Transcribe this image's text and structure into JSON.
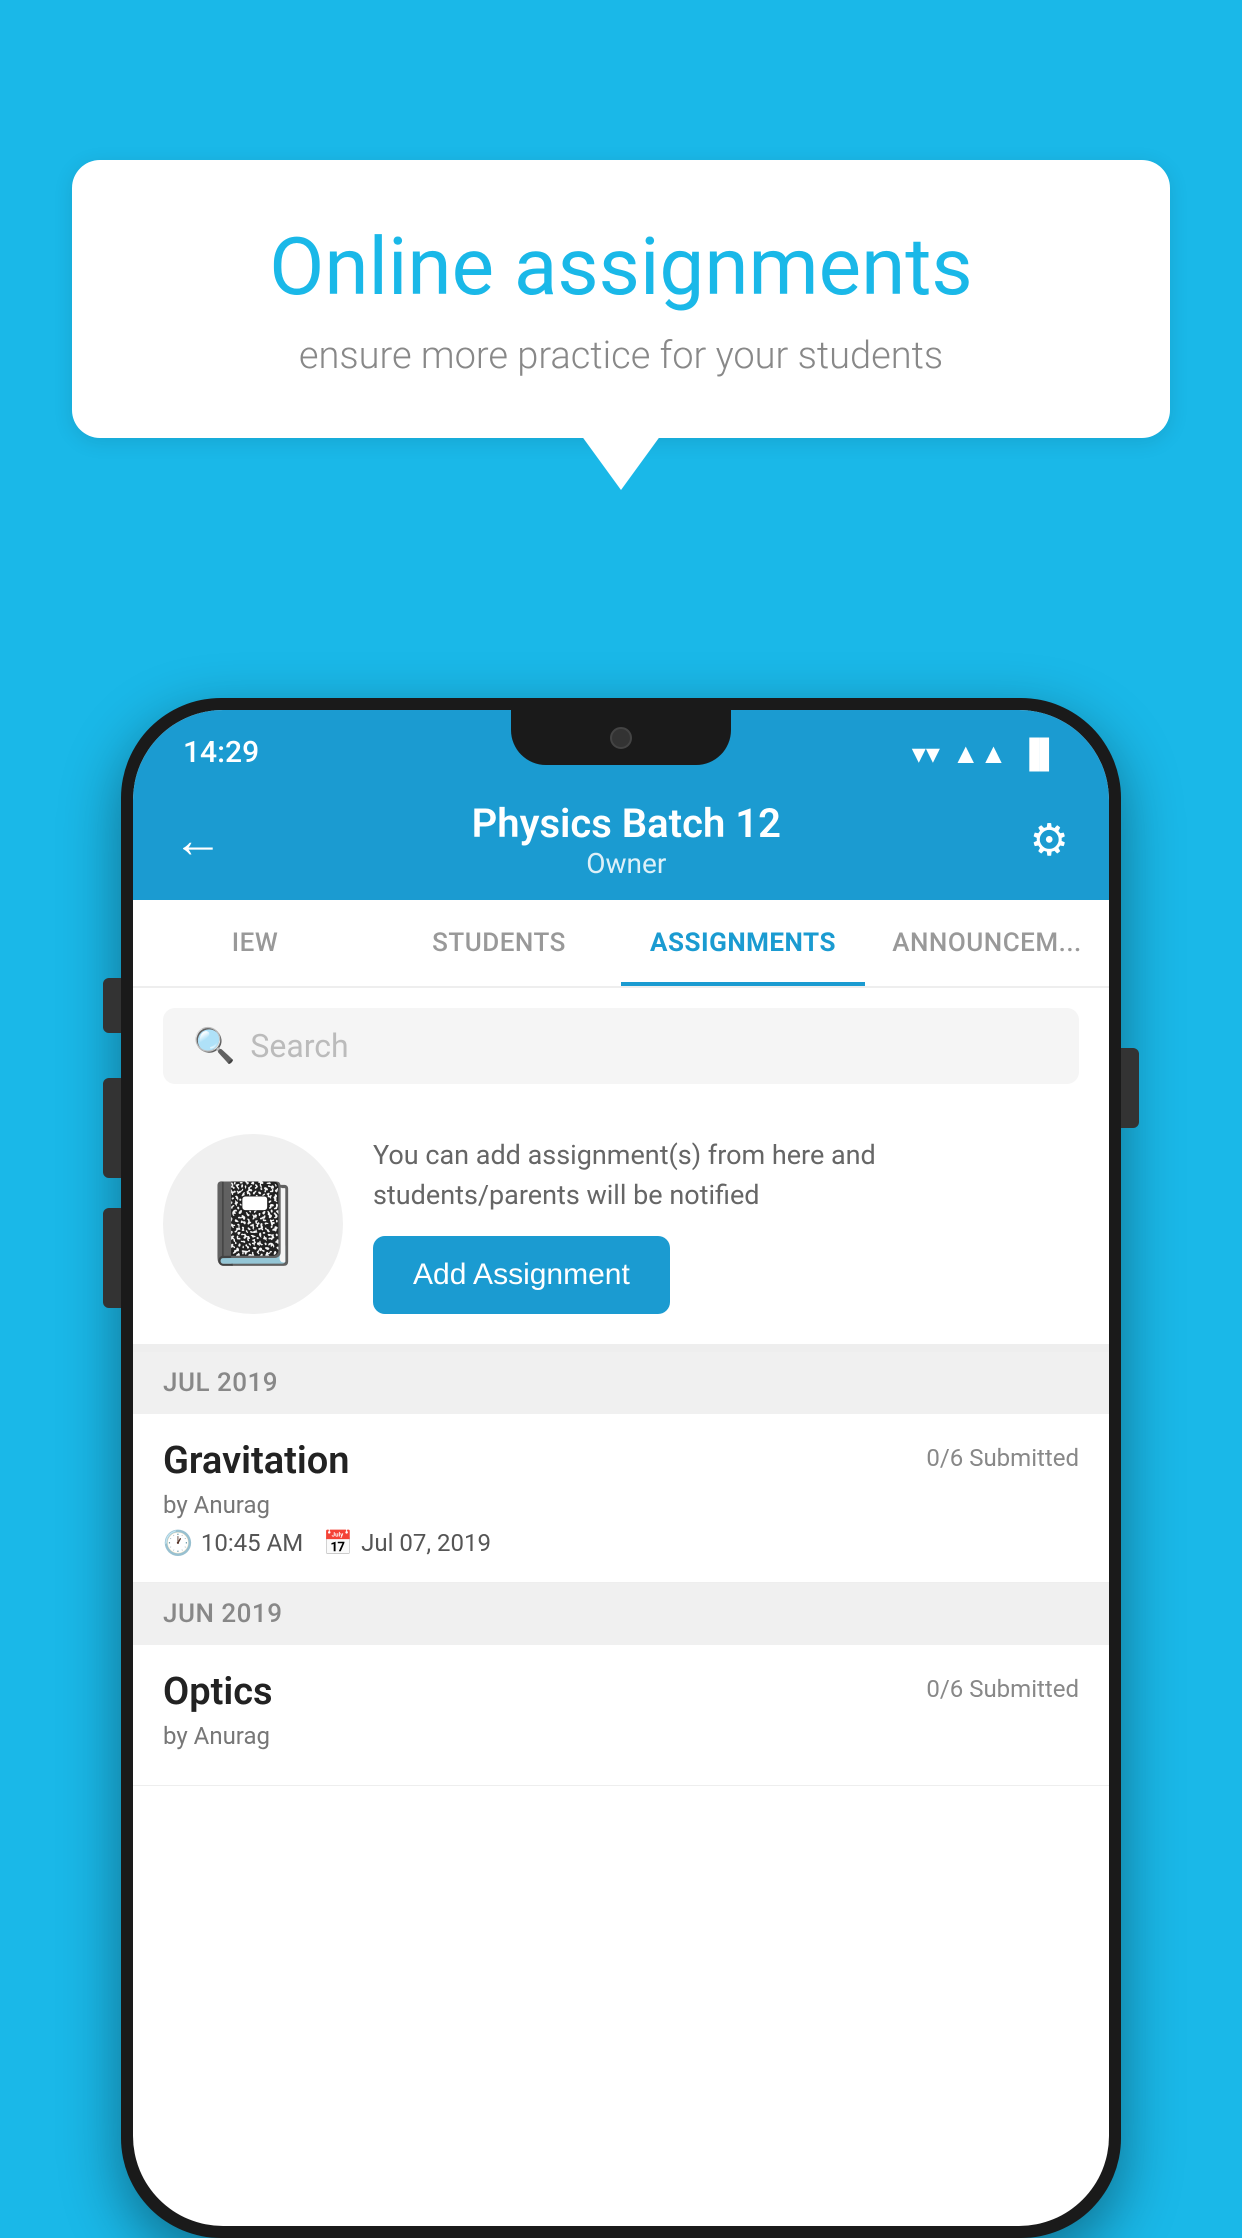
{
  "background": {
    "color": "#1ab8e8"
  },
  "speech_bubble": {
    "title": "Online assignments",
    "subtitle": "ensure more practice for your students"
  },
  "phone": {
    "status_bar": {
      "time": "14:29",
      "wifi": "▼",
      "signal": "▲",
      "battery": "▐"
    },
    "header": {
      "title": "Physics Batch 12",
      "subtitle": "Owner",
      "back_label": "←",
      "gear_label": "⚙"
    },
    "tabs": [
      {
        "label": "IEW",
        "active": false
      },
      {
        "label": "STUDENTS",
        "active": false
      },
      {
        "label": "ASSIGNMENTS",
        "active": true
      },
      {
        "label": "ANNOUNCEM...",
        "active": false
      }
    ],
    "search": {
      "placeholder": "Search"
    },
    "promo": {
      "icon": "📓",
      "description": "You can add assignment(s) from here and students/parents will be notified",
      "button_label": "Add Assignment"
    },
    "sections": [
      {
        "month_label": "JUL 2019",
        "assignments": [
          {
            "name": "Gravitation",
            "submitted": "0/6 Submitted",
            "by": "by Anurag",
            "time": "10:45 AM",
            "date": "Jul 07, 2019"
          }
        ]
      },
      {
        "month_label": "JUN 2019",
        "assignments": [
          {
            "name": "Optics",
            "submitted": "0/6 Submitted",
            "by": "by Anurag",
            "time": "",
            "date": ""
          }
        ]
      }
    ]
  }
}
